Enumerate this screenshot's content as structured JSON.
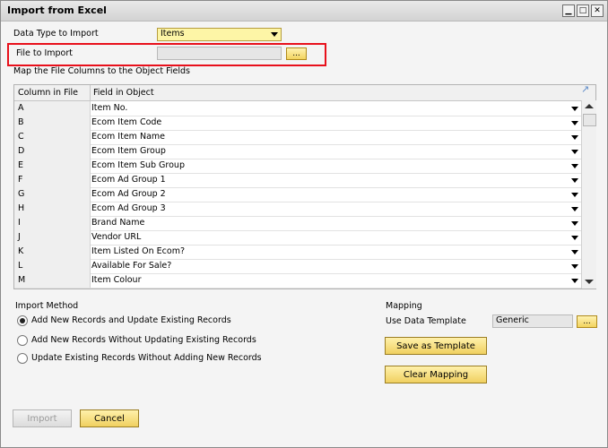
{
  "window": {
    "title": "Import from Excel",
    "minimize_glyph": "▁",
    "maximize_glyph": "□",
    "close_glyph": "✕"
  },
  "form": {
    "data_type_label": "Data Type to Import",
    "data_type_value": "Items",
    "file_label": "File to Import",
    "file_value": "",
    "browse_label": "...",
    "map_label": "Map the File Columns to the Object Fields"
  },
  "grid": {
    "headers": [
      "Column in File",
      "Field in Object"
    ],
    "rows": [
      {
        "col": "A",
        "field": "Item No."
      },
      {
        "col": "B",
        "field": "Ecom Item Code"
      },
      {
        "col": "C",
        "field": "Ecom Item Name"
      },
      {
        "col": "D",
        "field": "Ecom Item Group"
      },
      {
        "col": "E",
        "field": "Ecom Item Sub Group"
      },
      {
        "col": "F",
        "field": "Ecom Ad Group 1"
      },
      {
        "col": "G",
        "field": "Ecom Ad Group 2"
      },
      {
        "col": "H",
        "field": "Ecom Ad Group 3"
      },
      {
        "col": "I",
        "field": "Brand Name"
      },
      {
        "col": "J",
        "field": "Vendor URL"
      },
      {
        "col": "K",
        "field": "Item Listed On Ecom?"
      },
      {
        "col": "L",
        "field": "Available For Sale?"
      },
      {
        "col": "M",
        "field": "Item Colour"
      }
    ]
  },
  "import_method": {
    "label": "Import Method",
    "options": [
      {
        "label": "Add New Records and Update Existing Records",
        "selected": true
      },
      {
        "label": "Add New Records Without Updating Existing Records",
        "selected": false
      },
      {
        "label": "Update Existing Records Without Adding New Records",
        "selected": false
      }
    ]
  },
  "mapping": {
    "label": "Mapping",
    "template_label": "Use Data Template",
    "template_value": "Generic",
    "browse_label": "...",
    "save_button": "Save as Template",
    "clear_button": "Clear Mapping"
  },
  "footer": {
    "import_button": "Import",
    "cancel_button": "Cancel"
  },
  "colors": {
    "accent_yellow": "#fdf5a6",
    "highlight_red": "#e8101b"
  }
}
